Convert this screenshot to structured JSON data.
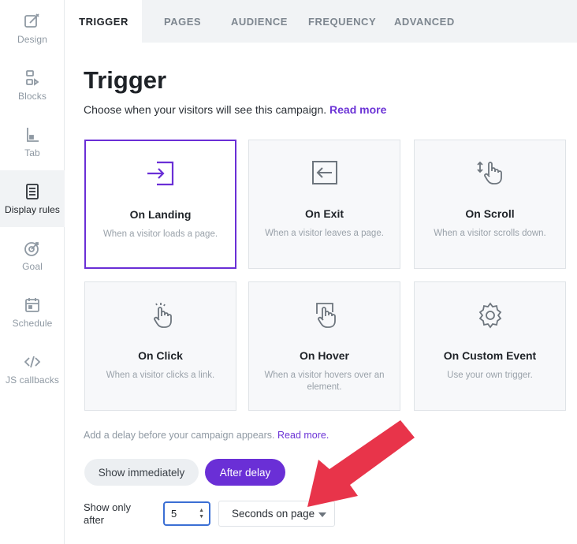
{
  "sidebar": {
    "items": [
      {
        "label": "Design",
        "icon": "design-icon"
      },
      {
        "label": "Blocks",
        "icon": "blocks-icon"
      },
      {
        "label": "Tab",
        "icon": "tab-icon"
      },
      {
        "label": "Display rules",
        "icon": "display-rules-icon",
        "active": true
      },
      {
        "label": "Goal",
        "icon": "goal-icon"
      },
      {
        "label": "Schedule",
        "icon": "schedule-icon"
      },
      {
        "label": "JS callbacks",
        "icon": "code-icon"
      }
    ]
  },
  "tabs": [
    {
      "label": "TRIGGER",
      "active": true
    },
    {
      "label": "PAGES"
    },
    {
      "label": "AUDIENCE"
    },
    {
      "label": "FREQUENCY"
    },
    {
      "label": "ADVANCED"
    }
  ],
  "main": {
    "title": "Trigger",
    "subtitle": "Choose when your visitors will see this campaign.",
    "subtitle_link": "Read more"
  },
  "triggers": [
    {
      "name": "On Landing",
      "desc": "When a visitor loads a page.",
      "icon": "enter-icon",
      "selected": true
    },
    {
      "name": "On Exit",
      "desc": "When a visitor leaves a page.",
      "icon": "exit-icon"
    },
    {
      "name": "On Scroll",
      "desc": "When a visitor scrolls down.",
      "icon": "scroll-hand-icon"
    },
    {
      "name": "On Click",
      "desc": "When a visitor clicks a link.",
      "icon": "click-hand-icon"
    },
    {
      "name": "On Hover",
      "desc": "When a visitor hovers over an element.",
      "icon": "hover-hand-icon"
    },
    {
      "name": "On Custom Event",
      "desc": "Use your own trigger.",
      "icon": "gear-icon"
    }
  ],
  "delay": {
    "note": "Add a delay before your campaign appears.",
    "note_link": "Read more.",
    "show_immediately": "Show immediately",
    "after_delay": "After delay",
    "show_only_after": "Show only after",
    "value": "5",
    "unit": "Seconds on page"
  },
  "colors": {
    "accent": "#6a2fd6",
    "annotation_arrow": "#e8344a"
  }
}
